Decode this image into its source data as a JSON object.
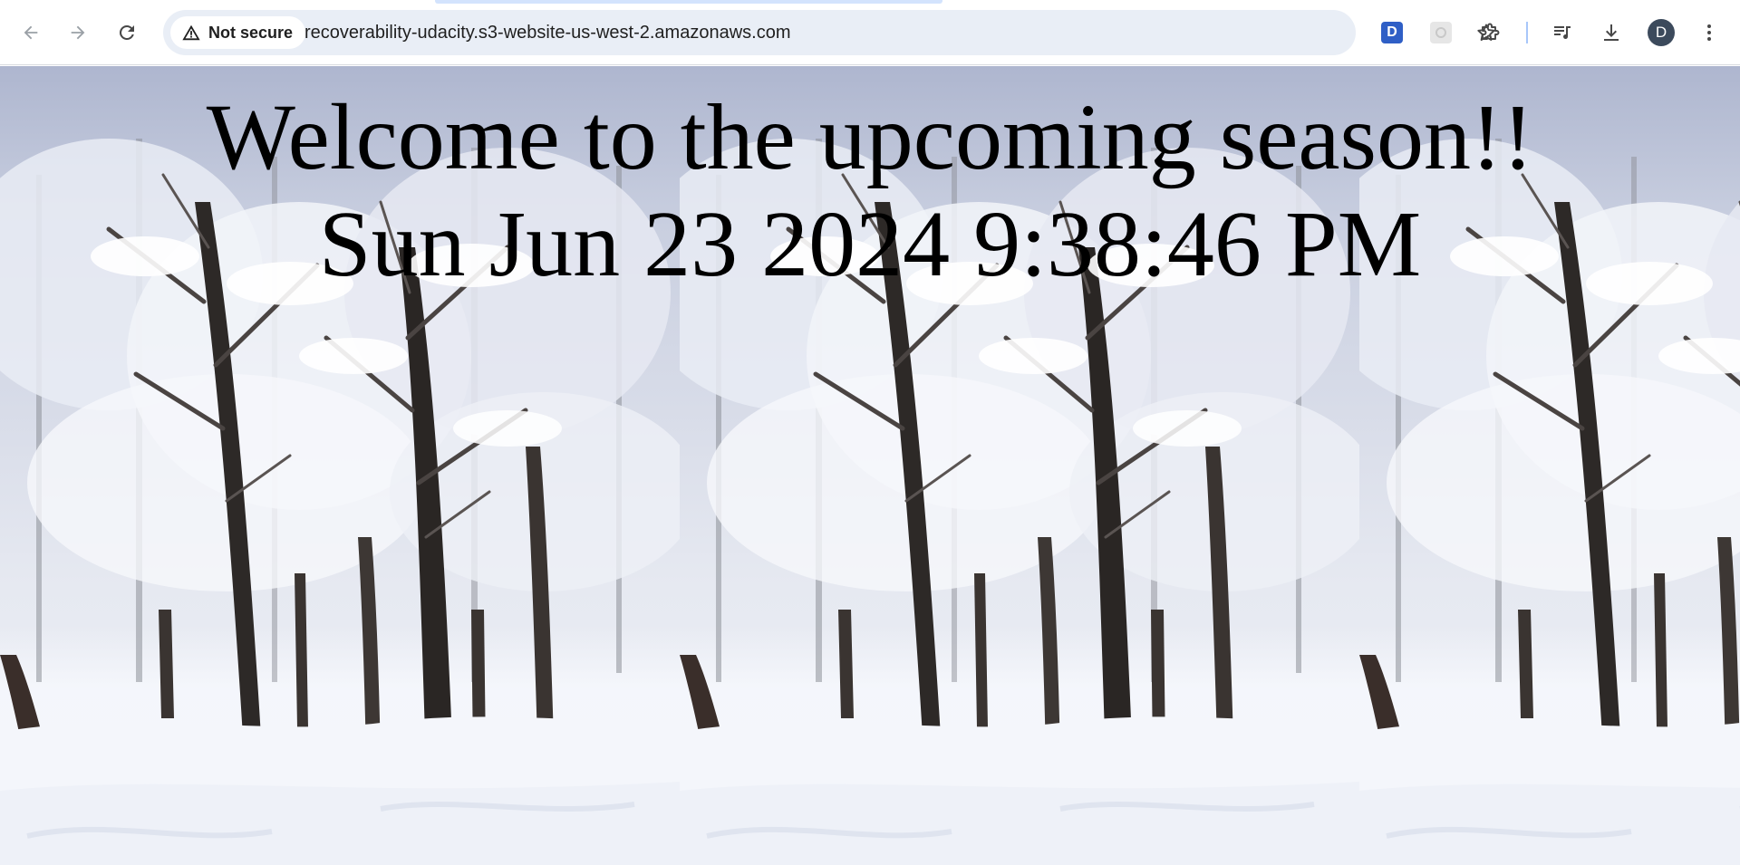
{
  "browser": {
    "security_label": "Not secure",
    "url": "recoverability-udacity.s3-website-us-west-2.amazonaws.com",
    "icons": {
      "back": "arrow-left-icon",
      "forward": "arrow-right-icon",
      "reload": "reload-icon",
      "warning": "warning-triangle-icon",
      "bookmark": "star-icon",
      "extension_1": "d-extension-icon",
      "extension_2": "grey-extension-icon",
      "extensions": "puzzle-icon",
      "media": "media-queue-icon",
      "downloads": "download-icon",
      "menu": "kebab-menu-icon"
    },
    "extension_letter": "D",
    "profile_initial": "D",
    "colors": {
      "omnibox_bg": "#e9eef6",
      "extension_blue": "#2f5fc6",
      "avatar_bg": "#3c4a5c"
    }
  },
  "page": {
    "heading_line1": "Welcome to the upcoming season!!",
    "heading_line2": "Sun Jun 23 2024 9:38:46 PM"
  }
}
